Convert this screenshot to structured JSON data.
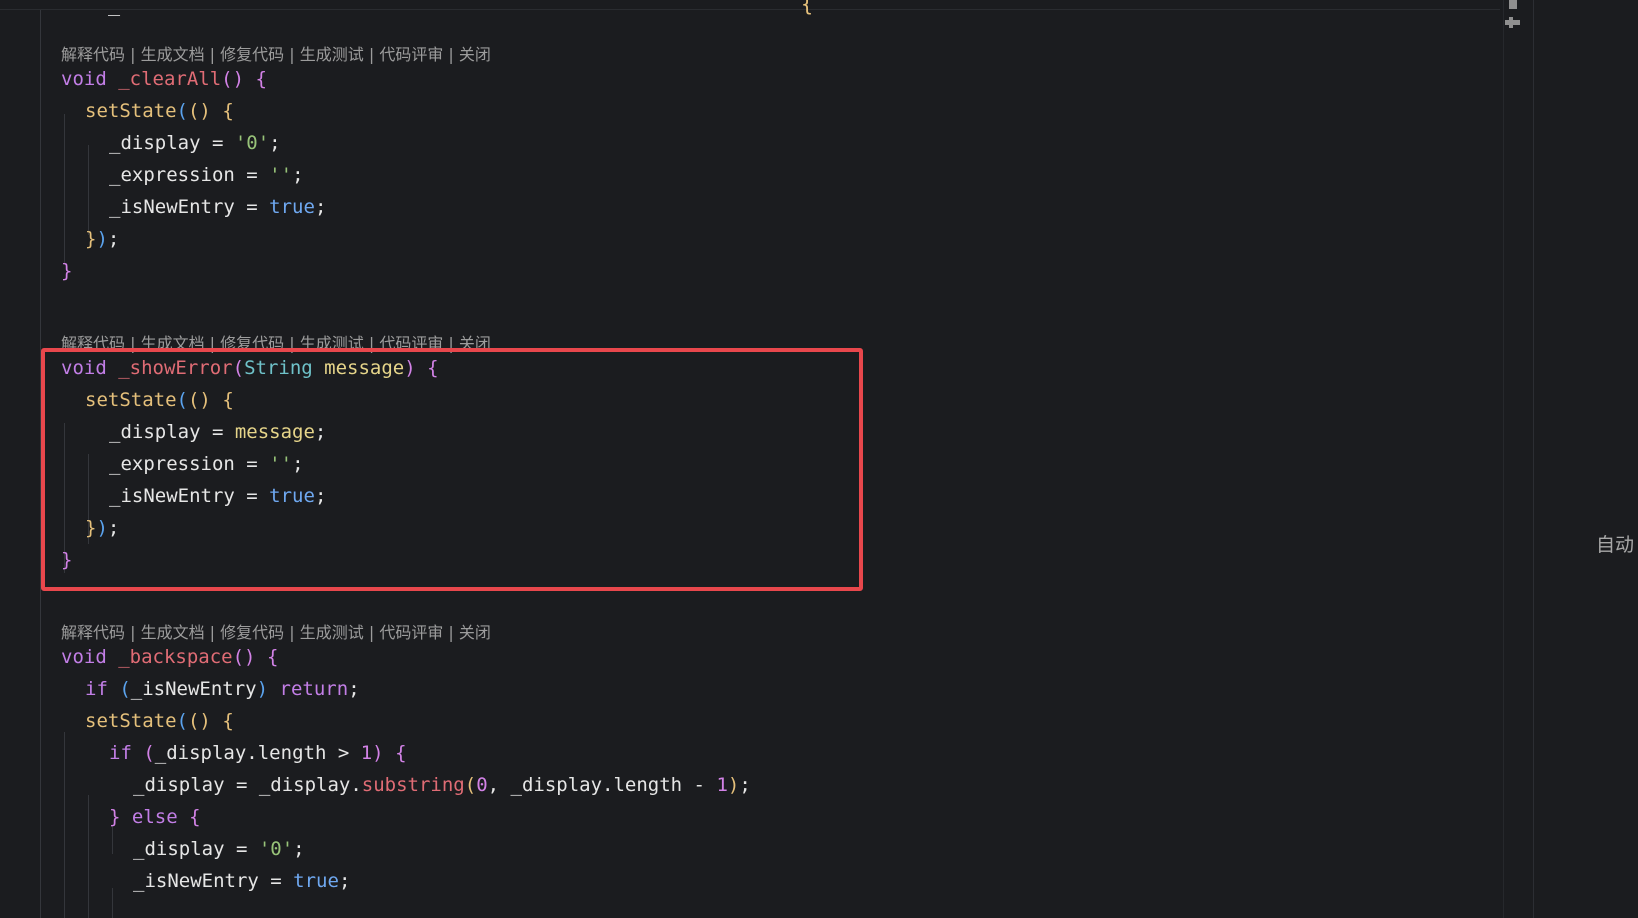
{
  "codelens": {
    "actions": [
      "解释代码",
      "生成文档",
      "修复代码",
      "生成测试",
      "代码评审",
      "关闭"
    ],
    "separator": " | "
  },
  "top_fragments": {
    "left": "_",
    "right": "{"
  },
  "code": {
    "clearAll": {
      "signature_void": "void",
      "signature_name": "_clearAll",
      "lines": {
        "display_var": "_display",
        "display_val": "'0'",
        "expression_var": "_expression",
        "expression_val": "''",
        "isnew_var": "_isNewEntry",
        "isnew_val": "true"
      }
    },
    "showError": {
      "signature_void": "void",
      "signature_name": "_showError",
      "param_type": "String",
      "param_name": "message",
      "lines": {
        "display_var": "_display",
        "display_val": "message",
        "expression_var": "_expression",
        "expression_val": "''",
        "isnew_var": "_isNewEntry",
        "isnew_val": "true"
      }
    },
    "backspace": {
      "signature_void": "void",
      "signature_name": "_backspace",
      "if_kw": "if",
      "if_cond": "_isNewEntry",
      "return_kw": "return",
      "inner_if_cond": "_display.length > ",
      "inner_if_num": "1",
      "display_var": "_display",
      "substring_obj": "_display.",
      "substring_fn": "substring",
      "substring_arg0": "0",
      "substring_arg1": ", _display.length - ",
      "substring_arg2": "1",
      "else_kw": "else",
      "else_display_val": "'0'",
      "isnew_var": "_isNewEntry",
      "isnew_val": "true"
    },
    "setState": "setState"
  },
  "right_panel": {
    "label": "自动"
  },
  "colors": {
    "background": "#1b1c1f",
    "highlight_border": "#e8474c",
    "keyword": "#c27ee6",
    "function": "#e5c07b",
    "string": "#98c379",
    "boolean": "#6fa8f0",
    "type": "#6fc2c9"
  }
}
